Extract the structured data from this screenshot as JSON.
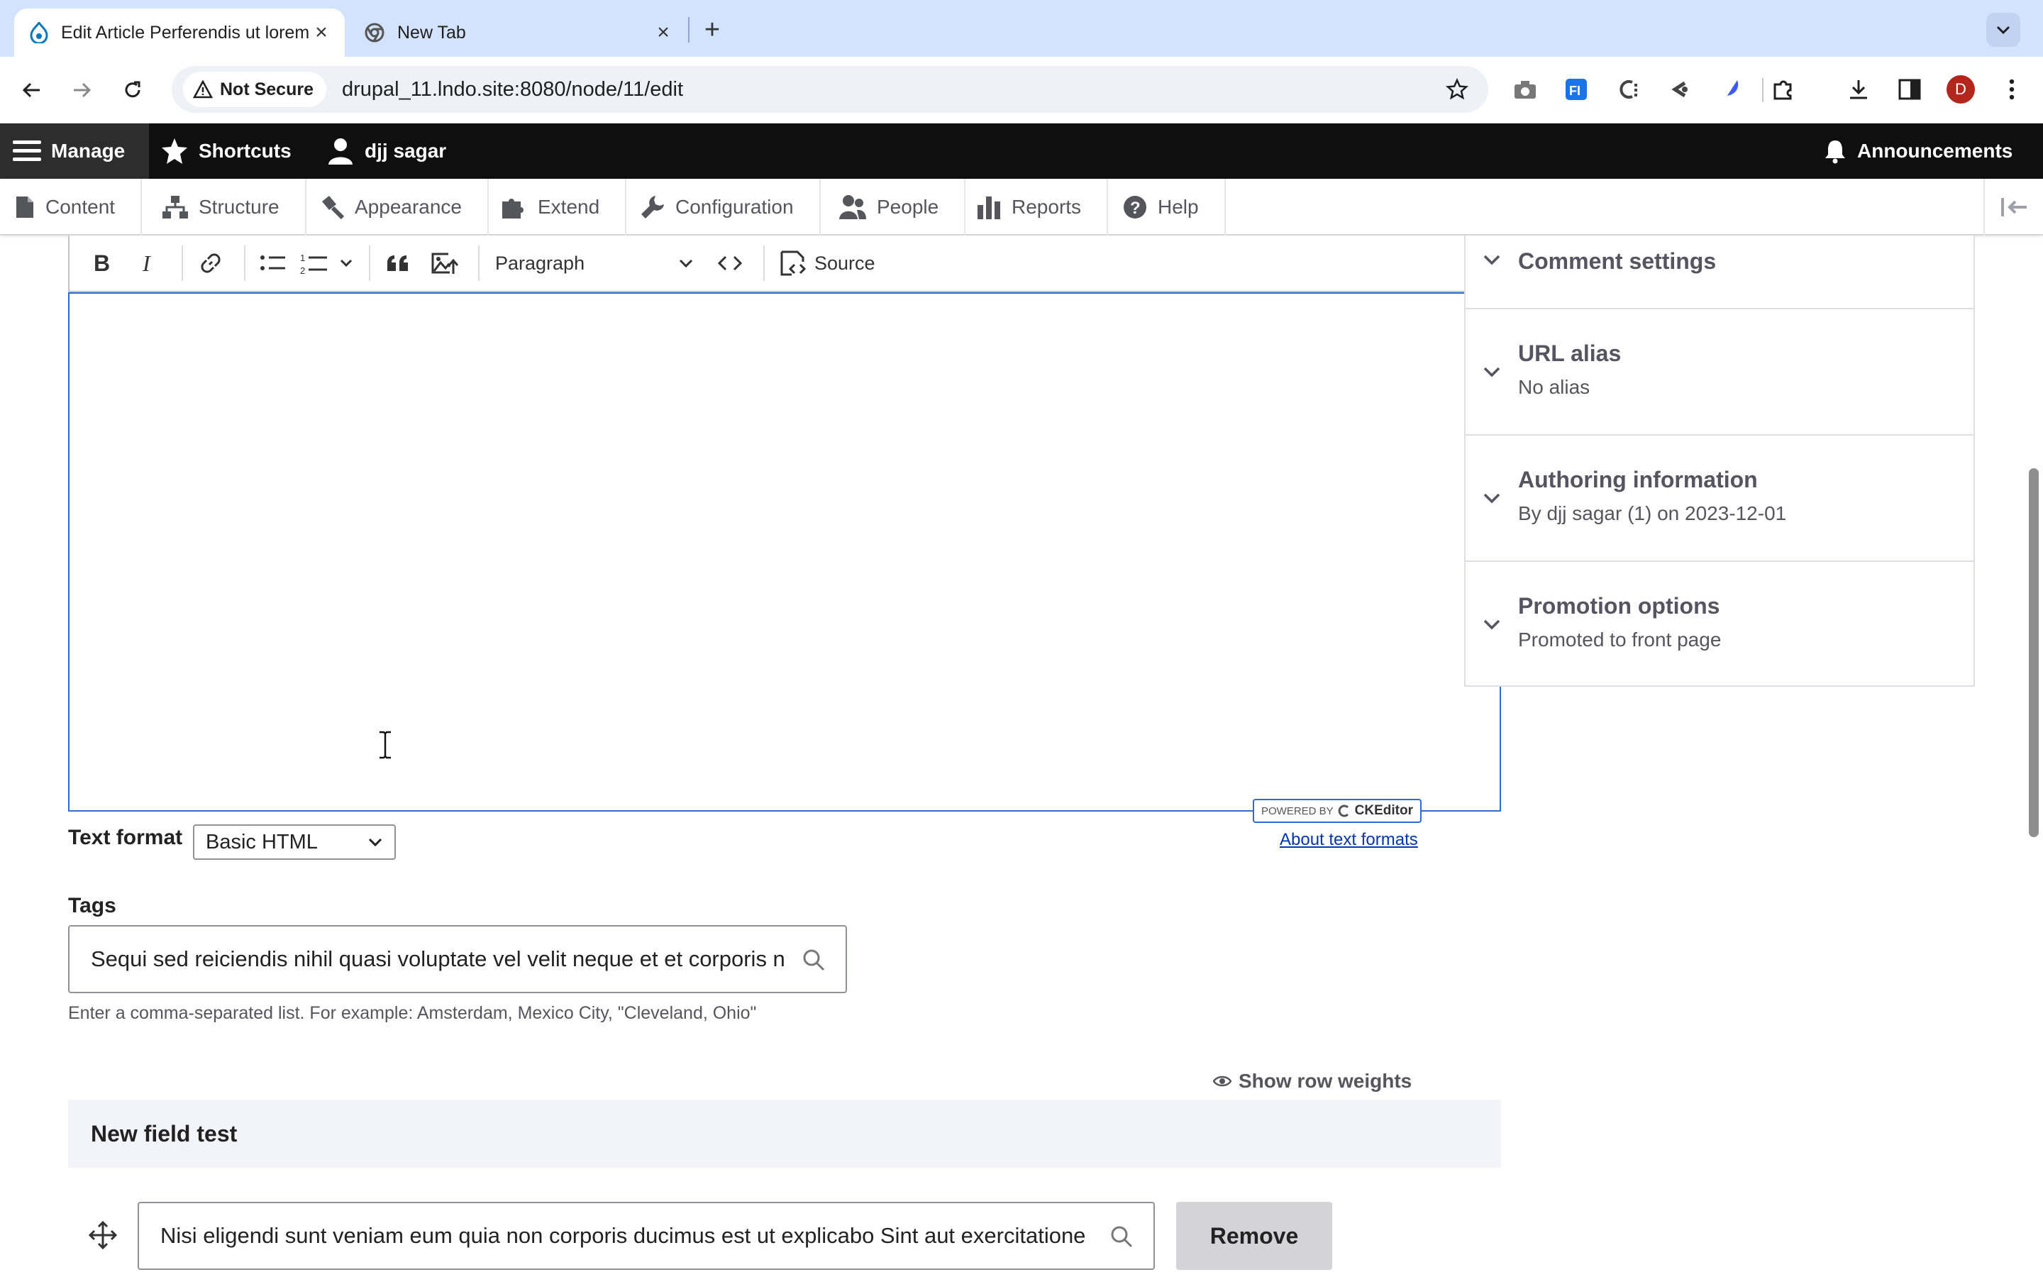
{
  "browser": {
    "tabs": [
      {
        "title": "Edit Article Perferendis ut lorem",
        "active": true
      },
      {
        "title": "New Tab",
        "active": false
      }
    ],
    "security_label": "Not Secure",
    "url": "drupal_11.lndo.site:8080/node/11/edit",
    "profile_initial": "D",
    "extension_icons": [
      "camera-icon",
      "formulas-extension-icon",
      "tagged-extension-icon",
      "reload-extension-icon",
      "feather-extension-icon",
      "puzzle-extensions-icon",
      "download-icon",
      "side-panel-icon"
    ]
  },
  "admin_toolbar": {
    "manage": "Manage",
    "shortcuts": "Shortcuts",
    "user": "djj sagar",
    "announcements": "Announcements"
  },
  "tray": {
    "items": [
      "Content",
      "Structure",
      "Appearance",
      "Extend",
      "Configuration",
      "People",
      "Reports",
      "Help"
    ]
  },
  "editor": {
    "heading_value": "Paragraph",
    "source_label": "Source",
    "powered_by": "POWERED BY",
    "ckeditor": "CKEditor",
    "text_format_label": "Text format",
    "text_format_value": "Basic HTML",
    "about_text_formats": "About text formats"
  },
  "tags": {
    "label": "Tags",
    "value": "Sequi sed reiciendis nihil quasi voluptate vel velit neque et et corporis n",
    "help": "Enter a comma-separated list. For example: Amsterdam, Mexico City, \"Cleveland, Ohio\""
  },
  "field": {
    "show_row_weights": "Show row weights",
    "header": "New field test",
    "value": "Nisi eligendi sunt veniam eum quia non corporis ducimus est ut explicabo Sint aut exercitatione",
    "remove": "Remove"
  },
  "sidebar": {
    "sections": [
      {
        "title": "Comment settings",
        "summary": ""
      },
      {
        "title": "URL alias",
        "summary": "No alias"
      },
      {
        "title": "Authoring information",
        "summary": "By djj sagar (1) on 2023-12-01"
      },
      {
        "title": "Promotion options",
        "summary": "Promoted to front page"
      }
    ]
  }
}
